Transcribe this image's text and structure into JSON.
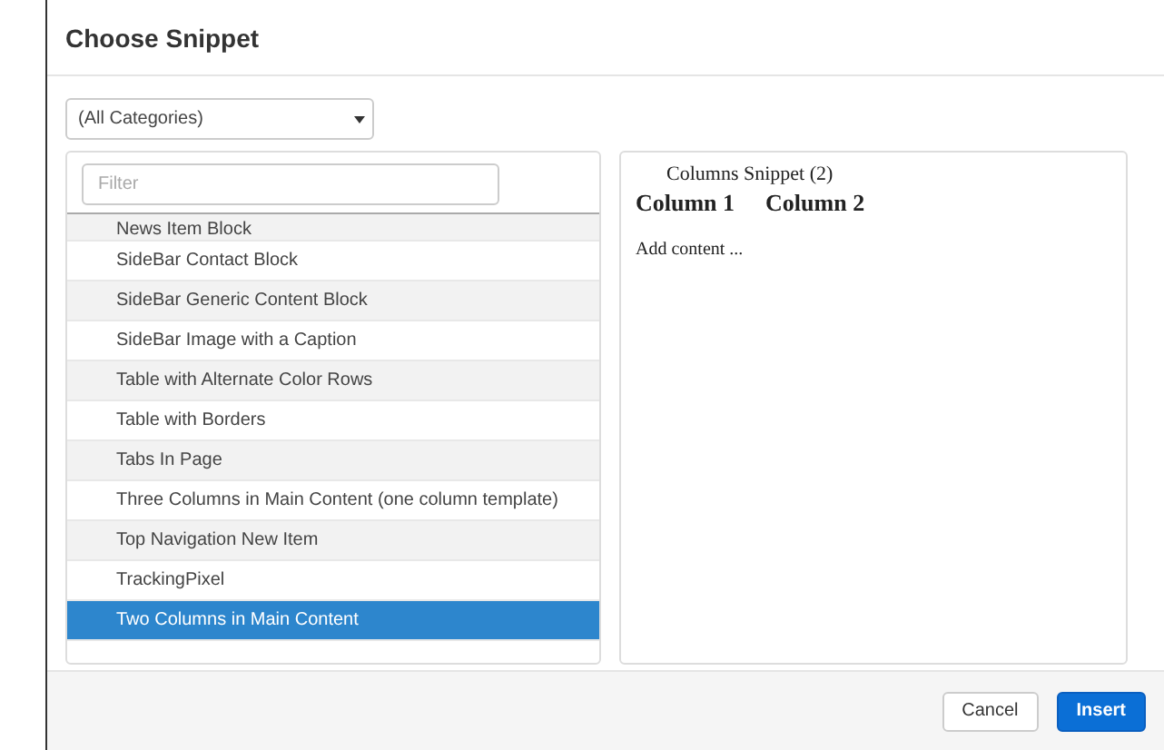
{
  "dialog": {
    "title": "Choose Snippet"
  },
  "category_select": {
    "value": "(All Categories)"
  },
  "filter": {
    "placeholder": "Filter"
  },
  "snippets": [
    {
      "label": "News Item Block",
      "selected": false
    },
    {
      "label": "SideBar Contact Block",
      "selected": false
    },
    {
      "label": "SideBar Generic Content Block",
      "selected": false
    },
    {
      "label": "SideBar Image with a Caption",
      "selected": false
    },
    {
      "label": "Table with Alternate Color Rows",
      "selected": false
    },
    {
      "label": "Table with Borders",
      "selected": false
    },
    {
      "label": "Tabs In Page",
      "selected": false
    },
    {
      "label": "Three Columns in Main Content (one column template)",
      "selected": false
    },
    {
      "label": "Top Navigation New Item",
      "selected": false
    },
    {
      "label": "TrackingPixel",
      "selected": false
    },
    {
      "label": "Two Columns in Main Content",
      "selected": true
    }
  ],
  "preview": {
    "caption": "Columns Snippet (2)",
    "headings": [
      "Column 1",
      "Column 2"
    ],
    "body": "Add content ..."
  },
  "buttons": [
    {
      "label": "Cancel",
      "kind": "secondary"
    },
    {
      "label": "Insert",
      "kind": "primary"
    }
  ]
}
